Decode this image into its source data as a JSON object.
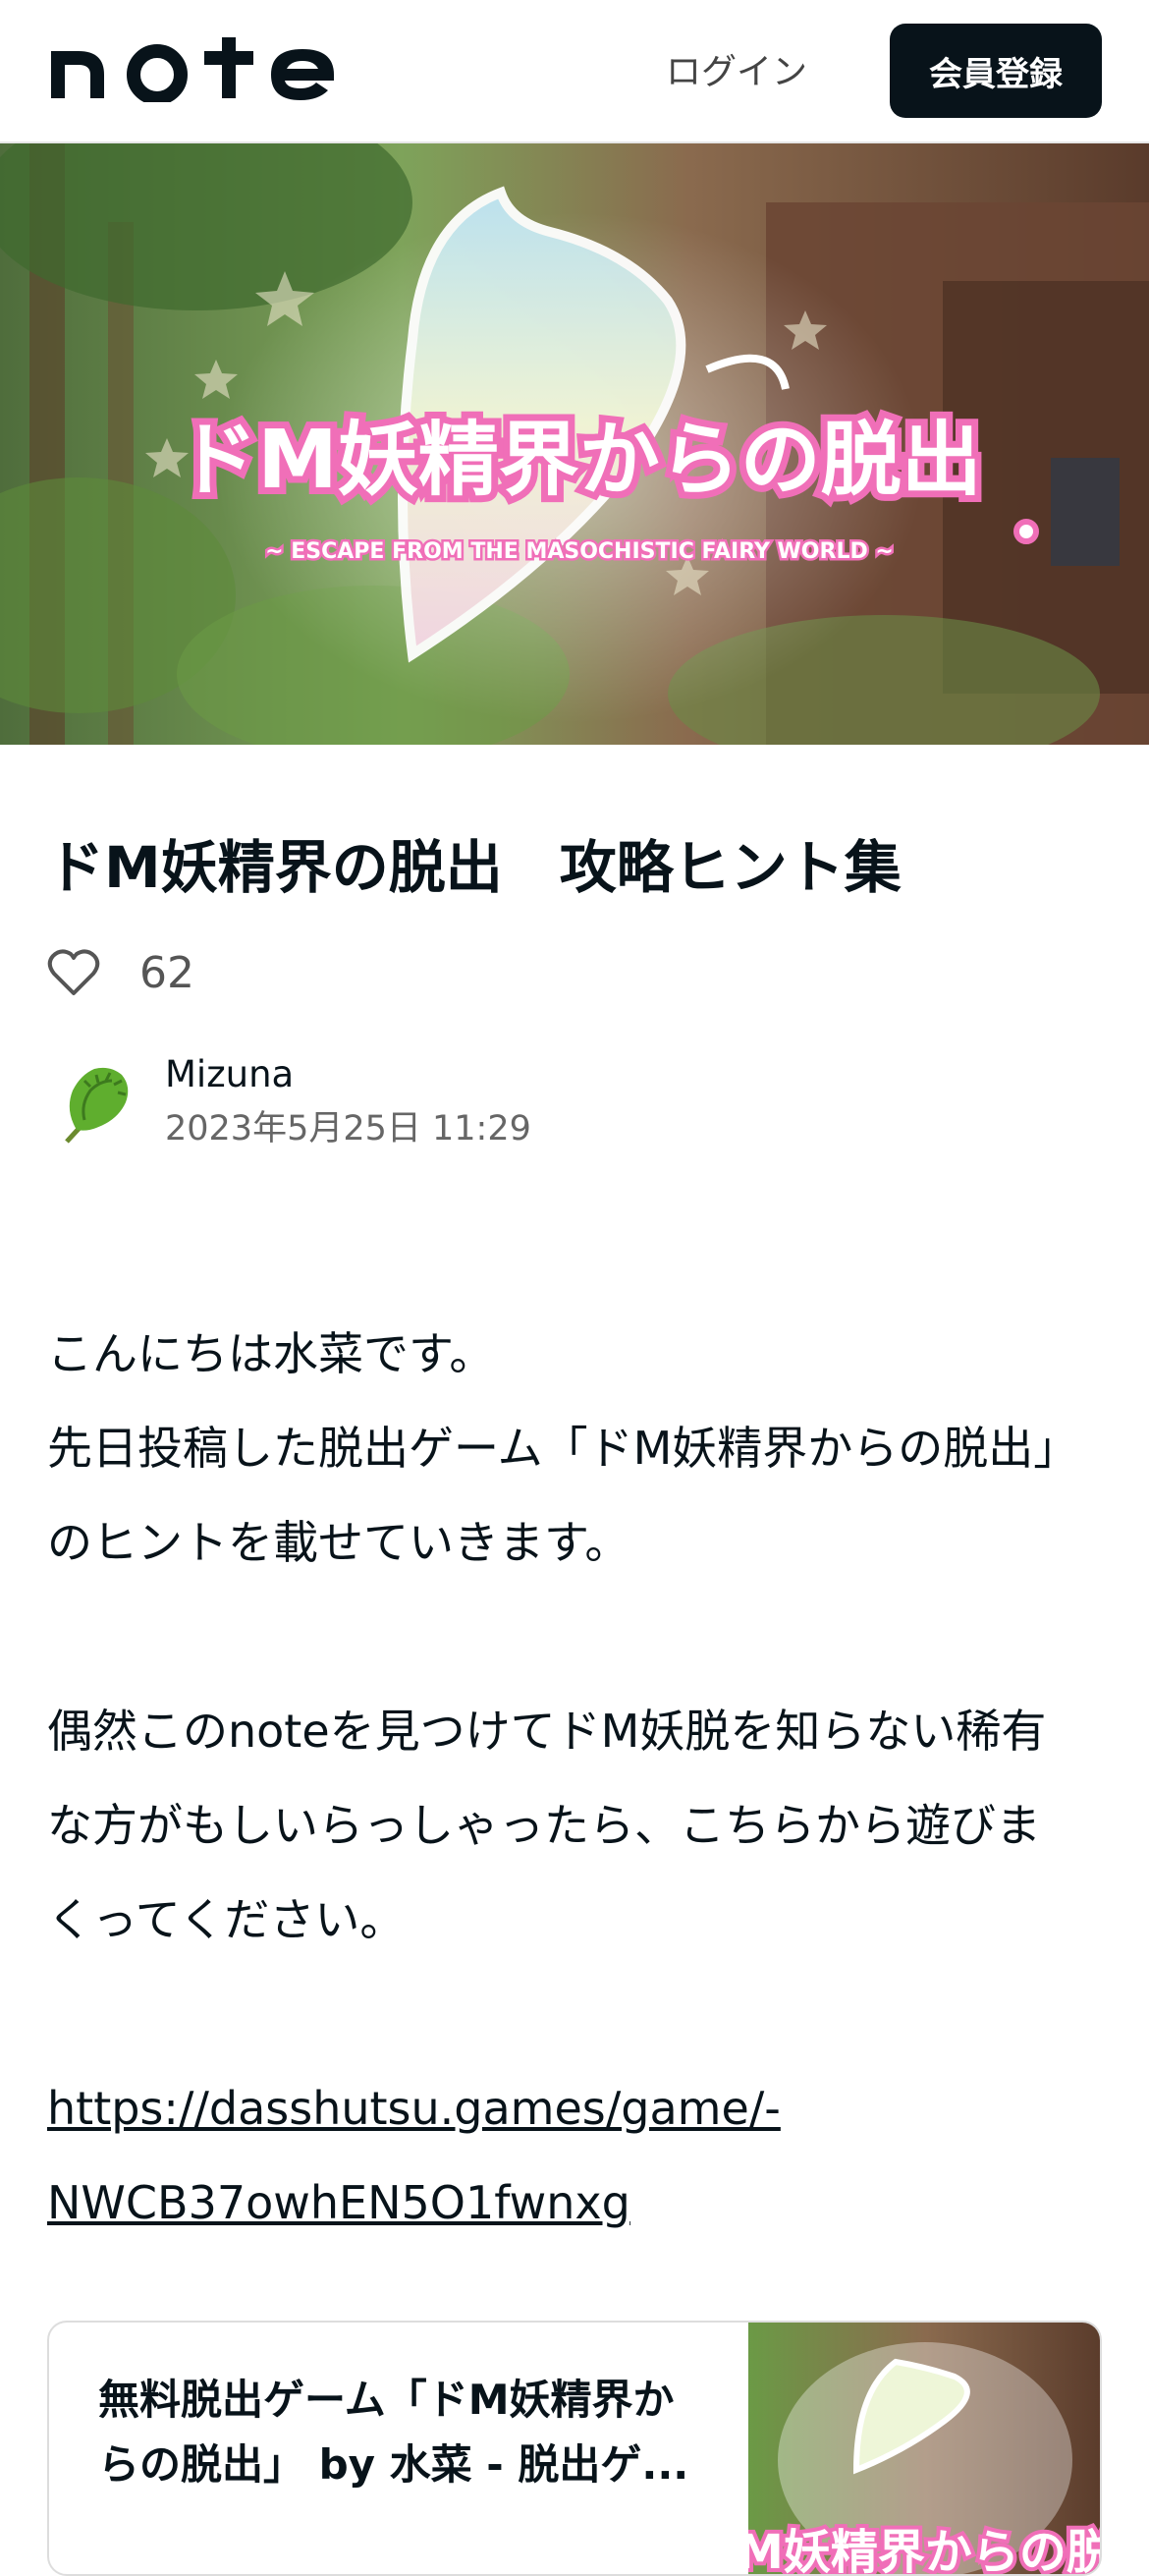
{
  "header": {
    "logo_text": "note",
    "login_label": "ログイン",
    "signup_label": "会員登録"
  },
  "hero": {
    "title_text": "ドM妖精界からの脱出",
    "subtitle_text": "~ ESCAPE FROM THE MASOCHISTIC FAIRY WORLD ~"
  },
  "article": {
    "title": "ドM妖精界の脱出　攻略ヒント集",
    "like_count": "62",
    "author_name": "Mizuna",
    "date": "2023年5月25日 11:29",
    "paragraphs": [
      [
        "こんにちは水菜です。",
        "先日投稿した脱出ゲーム「ドM妖精界からの脱出」",
        "のヒントを載せていきます。"
      ],
      [
        "偶然このnoteを見つけてドM妖脱を知らない稀有",
        "な方がもしいらっしゃったら、こちらから遊びま",
        "くってください。"
      ]
    ],
    "link_lines": [
      "https://dasshutsu.games/game/-",
      "NWCB37owhEN5O1fwnxg"
    ]
  },
  "embed": {
    "title_lines": [
      "無料脱出ゲーム「ドM妖精界か",
      "らの脱出」 by 水菜 - 脱出ゲ..."
    ]
  },
  "colors": {
    "primary": "#08131a",
    "accent_pink": "#f06fb8",
    "text_muted": "#666666"
  }
}
